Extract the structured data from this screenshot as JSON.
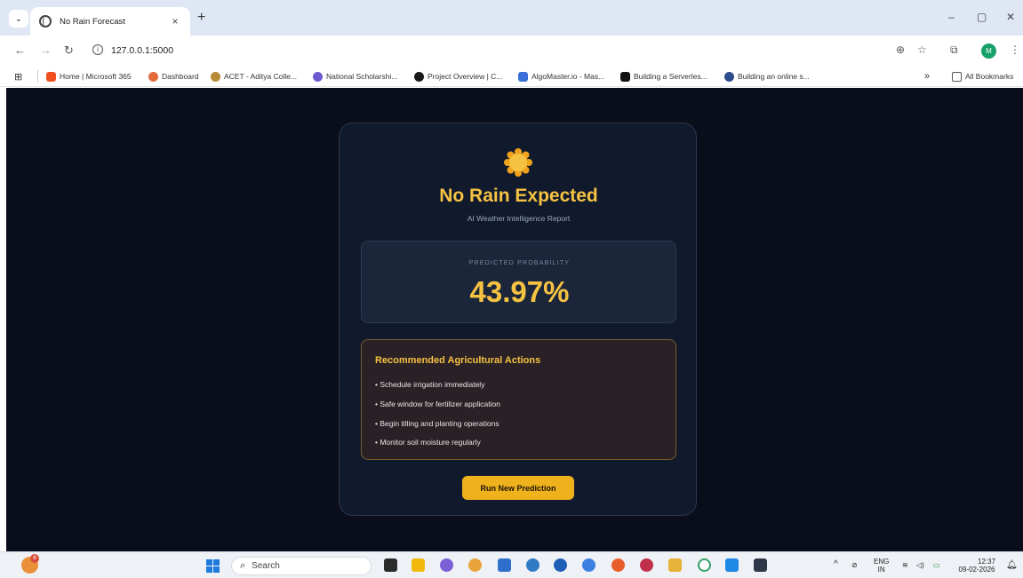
{
  "browser": {
    "tab_title": "No Rain Forecast",
    "tab_close": "×",
    "new_tab": "+",
    "url": "127.0.0.1:5000",
    "profile_initial": "M",
    "window_controls": {
      "minimize": "–",
      "restore": "▢",
      "close": "✕"
    }
  },
  "bookmarks": [
    {
      "label": "Home | Microsoft 365",
      "color": "#f25022"
    },
    {
      "label": "Dashboard",
      "color": "#e46a3a"
    },
    {
      "label": "ACET - Aditya Colle...",
      "color": "#b98a35"
    },
    {
      "label": "National Scholarshi...",
      "color": "#6a5acd"
    },
    {
      "label": "Project Overview | C...",
      "color": "#1a1a1a"
    },
    {
      "label": "AlgoMaster.io - Mas...",
      "color": "#3b6fd8"
    },
    {
      "label": "Building a Serverles...",
      "color": "#111111"
    },
    {
      "label": "Building an online s...",
      "color": "#2c4c8c"
    }
  ],
  "bookmarks_overflow": "»",
  "all_bookmarks": "All Bookmarks",
  "page": {
    "headline": "No Rain Expected",
    "subtitle": "AI Weather Intelligence Report",
    "probability_label": "PREDICTED PROBABILITY",
    "probability_value": "43.97%",
    "actions_title": "Recommended Agricultural Actions",
    "actions": [
      "• Schedule irrigation immediately",
      "• Safe window for fertilizer application",
      "• Begin tilling and planting operations",
      "• Monitor soil moisture regularly"
    ],
    "run_button": "Run New Prediction",
    "accent_color": "#f5c242"
  },
  "taskbar": {
    "weather_badge": "6",
    "search_placeholder": "Search",
    "lang_top": "ENG",
    "lang_bottom": "IN",
    "time": "12:37",
    "date": "09-02-2026"
  }
}
